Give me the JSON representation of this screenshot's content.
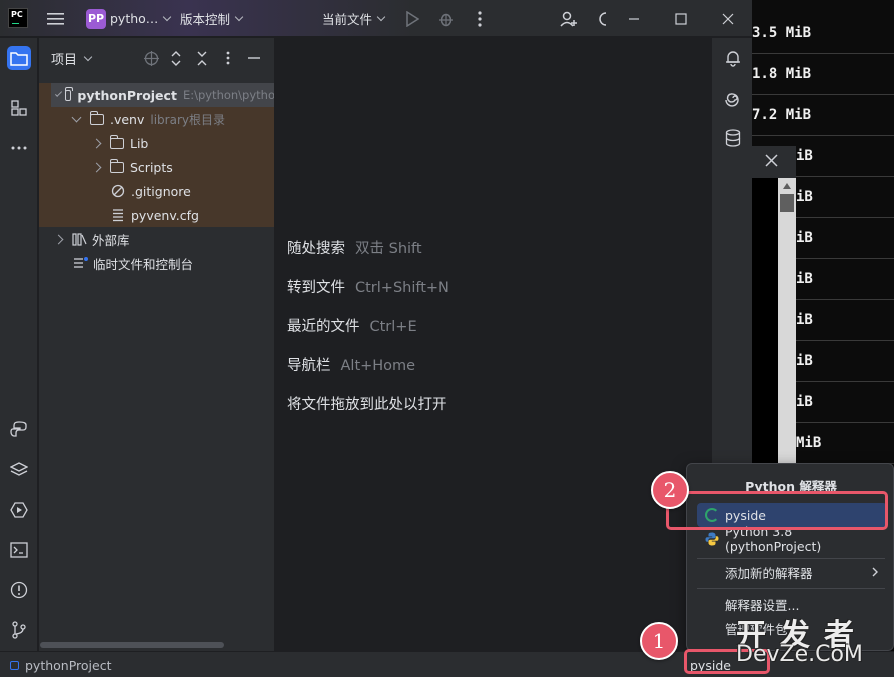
{
  "titlebar": {
    "app_logo": "PC",
    "project_badge": "PP",
    "project_name": "pytho…",
    "vcs_menu": "版本控制",
    "run_config": "当前文件"
  },
  "left_strip": {
    "icons": [
      "folder-icon",
      "structure-icon",
      "more-icon",
      "python-console-icon",
      "layers-icon",
      "services-icon",
      "terminal-icon",
      "problems-icon",
      "git-icon"
    ]
  },
  "project_panel": {
    "title": "项目",
    "tree": [
      {
        "label": "pythonProject",
        "extra": "E:\\python\\pytho"
      },
      {
        "label": ".venv",
        "extra": "library根目录"
      },
      {
        "label": "Lib",
        "extra": ""
      },
      {
        "label": "Scripts",
        "extra": ""
      },
      {
        "label": ".gitignore",
        "extra": ""
      },
      {
        "label": "pyvenv.cfg",
        "extra": ""
      },
      {
        "label": "外部库",
        "extra": ""
      },
      {
        "label": "临时文件和控制台",
        "extra": ""
      }
    ]
  },
  "editor": {
    "hints": [
      {
        "action": "随处搜索",
        "key": "双击 Shift"
      },
      {
        "action": "转到文件",
        "key": "Ctrl+Shift+N"
      },
      {
        "action": "最近的文件",
        "key": "Ctrl+E"
      },
      {
        "action": "导航栏",
        "key": "Alt+Home"
      },
      {
        "action": "将文件拖放到此处以打开",
        "key": ""
      }
    ]
  },
  "terminal": {
    "rows": [
      "3.5 MiB",
      "1.8 MiB",
      "7.2 MiB",
      "iB",
      "iB",
      "iB",
      "iB",
      "iB",
      "iB",
      "iB",
      "MiB"
    ]
  },
  "popup": {
    "title": "Python 解释器",
    "items": [
      {
        "label": "pyside",
        "icon": "loading-spinner-icon"
      },
      {
        "label": "Python 3.8 (pythonProject)",
        "icon": "python-icon"
      }
    ],
    "add_new": "添加新的解释器",
    "settings": "解释器设置...",
    "manage": "管理软件包..."
  },
  "statusbar": {
    "breadcrumb": "pythonProject",
    "interpreter": "pyside"
  },
  "annotations": {
    "badge_1": "1",
    "badge_2": "2",
    "color": "#e8576a"
  },
  "watermark": {
    "top": "开发者",
    "bottom": "DevZe.CoM"
  },
  "colors": {
    "accent": "#3574f0",
    "selection": "#2e436e",
    "highlight_bg": "#47372a"
  }
}
